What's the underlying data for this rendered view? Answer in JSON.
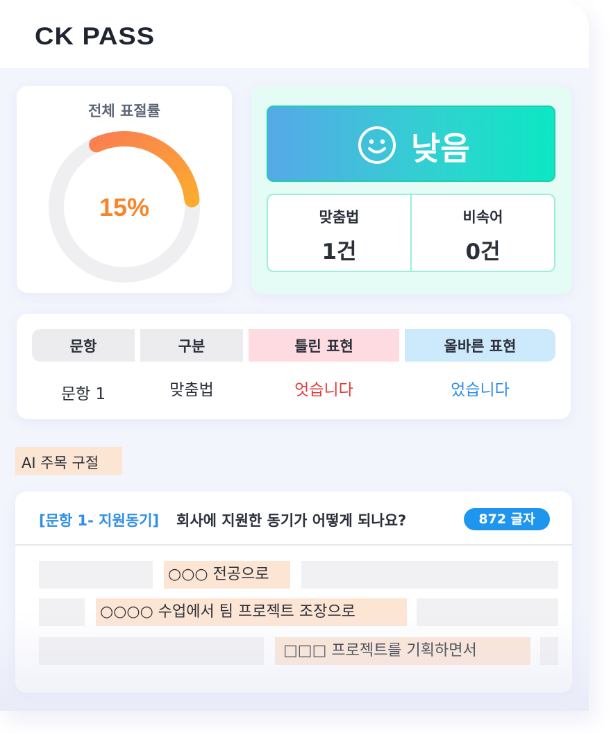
{
  "brand": {
    "logo": "CK PASS"
  },
  "plagiarism": {
    "title": "전체 표절률",
    "rate_label": "15%",
    "rate_fraction": 0.15,
    "ring_color": "#f7862b"
  },
  "level": {
    "label": "낮음",
    "icon": "smile-icon",
    "stats": [
      {
        "label": "맞춤법",
        "value": "1건"
      },
      {
        "label": "비속어",
        "value": "0건"
      }
    ]
  },
  "table": {
    "headers": [
      "문항",
      "구분",
      "틀린 표현",
      "올바른 표현"
    ],
    "rows": [
      {
        "item": "문항 1",
        "category": "맞춤법",
        "wrong": "엇습니다",
        "correct": "었습니다"
      }
    ]
  },
  "ai": {
    "tag": "AI 주목 구절"
  },
  "essay": {
    "question_prefix": "[문항 1- 지원동기]",
    "question": "회사에 지원한 동기가 어떻게 되나요?",
    "char_count": "872 글자",
    "highlights": [
      "○○○ 전공으로",
      "○○○○ 수업에서 팀 프로젝트 조장으로",
      "□□□ 프로젝트를 기획하면서"
    ]
  }
}
